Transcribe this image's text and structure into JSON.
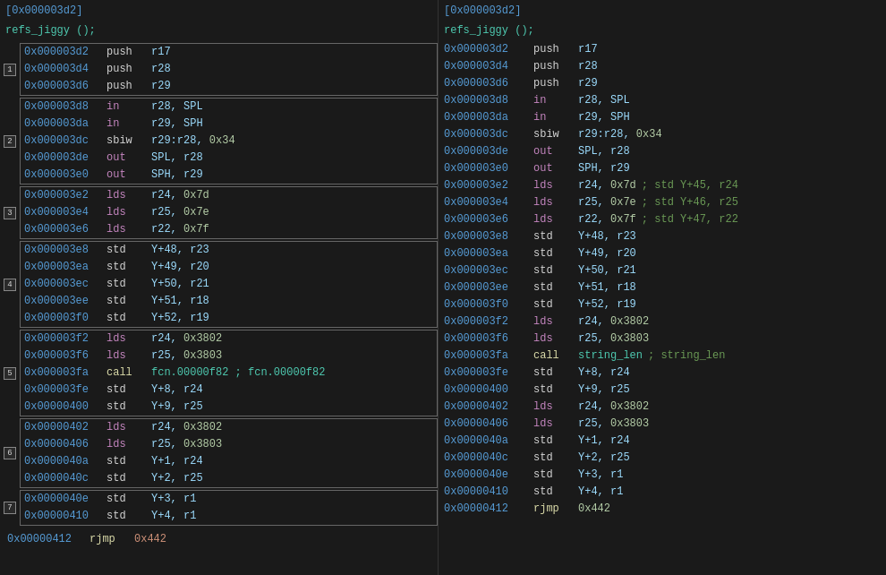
{
  "panels": [
    {
      "id": "left",
      "header_addr": "[0x000003d2]",
      "func_header": "refs_jiggy ();",
      "groups": [
        {
          "num": "1",
          "rows": [
            {
              "addr": "0x000003d2",
              "mnem": "push",
              "mnem_class": "c-grey",
              "ops": "r17",
              "ops_class": "c-light"
            },
            {
              "addr": "0x000003d4",
              "mnem": "push",
              "mnem_class": "c-grey",
              "ops": "r28",
              "ops_class": "c-light"
            },
            {
              "addr": "0x000003d6",
              "mnem": "push",
              "mnem_class": "c-grey",
              "ops": "r29",
              "ops_class": "c-light"
            }
          ]
        },
        {
          "num": "2",
          "rows": [
            {
              "addr": "0x000003d8",
              "mnem": "in",
              "mnem_class": "c-purple",
              "ops": "r28, SPL",
              "ops_class": "c-light"
            },
            {
              "addr": "0x000003da",
              "mnem": "in",
              "mnem_class": "c-purple",
              "ops": "r29, SPH",
              "ops_class": "c-light"
            },
            {
              "addr": "0x000003dc",
              "mnem": "sbiw",
              "mnem_class": "c-grey",
              "ops": "r29:r28, 0x34",
              "ops_class": "c-light",
              "ops_hex": "0x34"
            },
            {
              "addr": "0x000003de",
              "mnem": "out",
              "mnem_class": "c-purple",
              "ops": "SPL, r28",
              "ops_class": "c-light"
            },
            {
              "addr": "0x000003e0",
              "mnem": "out",
              "mnem_class": "c-purple",
              "ops": "SPH, r29",
              "ops_class": "c-light"
            }
          ]
        },
        {
          "num": "3",
          "rows": [
            {
              "addr": "0x000003e2",
              "mnem": "lds",
              "mnem_class": "c-purple",
              "ops": "r24, 0x7d",
              "ops_class": "c-light",
              "ops_hex": "0x7d"
            },
            {
              "addr": "0x000003e4",
              "mnem": "lds",
              "mnem_class": "c-purple",
              "ops": "r25, 0x7e",
              "ops_class": "c-light",
              "ops_hex": "0x7e"
            },
            {
              "addr": "0x000003e6",
              "mnem": "lds",
              "mnem_class": "c-purple",
              "ops": "r22, 0x7f",
              "ops_class": "c-light",
              "ops_hex": "0x7f"
            }
          ]
        },
        {
          "num": "4",
          "rows": [
            {
              "addr": "0x000003e8",
              "mnem": "std",
              "mnem_class": "c-grey",
              "ops": "Y+48, r23",
              "ops_class": "c-light"
            },
            {
              "addr": "0x000003ea",
              "mnem": "std",
              "mnem_class": "c-grey",
              "ops": "Y+49, r20",
              "ops_class": "c-light"
            },
            {
              "addr": "0x000003ec",
              "mnem": "std",
              "mnem_class": "c-grey",
              "ops": "Y+50, r21",
              "ops_class": "c-light"
            },
            {
              "addr": "0x000003ee",
              "mnem": "std",
              "mnem_class": "c-grey",
              "ops": "Y+51, r18",
              "ops_class": "c-light"
            },
            {
              "addr": "0x000003f0",
              "mnem": "std",
              "mnem_class": "c-grey",
              "ops": "Y+52, r19",
              "ops_class": "c-light"
            }
          ]
        },
        {
          "num": "5",
          "rows": [
            {
              "addr": "0x000003f2",
              "mnem": "lds",
              "mnem_class": "c-purple",
              "ops": "r24, 0x3802",
              "ops_class": "c-light",
              "ops_hex": "0x3802"
            },
            {
              "addr": "0x000003f6",
              "mnem": "lds",
              "mnem_class": "c-purple",
              "ops": "r25, 0x3803",
              "ops_class": "c-light",
              "ops_hex": "0x3803"
            },
            {
              "addr": "0x000003fa",
              "mnem": "call",
              "mnem_class": "c-yellow",
              "ops": "fcn.00000f82 ; fcn.00000f82",
              "ops_class": "c-teal"
            },
            {
              "addr": "0x000003fe",
              "mnem": "std",
              "mnem_class": "c-grey",
              "ops": "Y+8, r24",
              "ops_class": "c-light"
            },
            {
              "addr": "0x00000400",
              "mnem": "std",
              "mnem_class": "c-grey",
              "ops": "Y+9, r25",
              "ops_class": "c-light"
            }
          ]
        },
        {
          "num": "6",
          "rows": [
            {
              "addr": "0x00000402",
              "mnem": "lds",
              "mnem_class": "c-purple",
              "ops": "r24, 0x3802",
              "ops_class": "c-light",
              "ops_hex": "0x3802"
            },
            {
              "addr": "0x00000406",
              "mnem": "lds",
              "mnem_class": "c-purple",
              "ops": "r25, 0x3803",
              "ops_class": "c-light",
              "ops_hex": "0x3803"
            },
            {
              "addr": "0x0000040a",
              "mnem": "std",
              "mnem_class": "c-grey",
              "ops": "Y+1, r24",
              "ops_class": "c-light"
            },
            {
              "addr": "0x0000040c",
              "mnem": "std",
              "mnem_class": "c-grey",
              "ops": "Y+2, r25",
              "ops_class": "c-light"
            }
          ]
        },
        {
          "num": "7",
          "rows": [
            {
              "addr": "0x0000040e",
              "mnem": "std",
              "mnem_class": "c-grey",
              "ops": "Y+3, r1",
              "ops_class": "c-light"
            },
            {
              "addr": "0x00000410",
              "mnem": "std",
              "mnem_class": "c-grey",
              "ops": "Y+4, r1",
              "ops_class": "c-light"
            }
          ]
        }
      ],
      "footer_rows": [
        {
          "addr": "0x00000412",
          "mnem": "rjmp",
          "mnem_class": "c-yellow",
          "ops": "0x442",
          "ops_class": "c-orange"
        }
      ]
    },
    {
      "id": "right",
      "header_addr": "[0x000003d2]",
      "func_header": "refs_jiggy ();",
      "rows": [
        {
          "addr": "0x000003d2",
          "mnem": "push",
          "mnem_class": "c-grey",
          "ops": "r17",
          "comment": ""
        },
        {
          "addr": "0x000003d4",
          "mnem": "push",
          "mnem_class": "c-grey",
          "ops": "r28",
          "comment": ""
        },
        {
          "addr": "0x000003d6",
          "mnem": "push",
          "mnem_class": "c-grey",
          "ops": "r29",
          "comment": ""
        },
        {
          "addr": "0x000003d8",
          "mnem": "in",
          "mnem_class": "c-purple",
          "ops": "r28, SPL",
          "comment": ""
        },
        {
          "addr": "0x000003da",
          "mnem": "in",
          "mnem_class": "c-purple",
          "ops": "r29, SPH",
          "comment": ""
        },
        {
          "addr": "0x000003dc",
          "mnem": "sbiw",
          "mnem_class": "c-grey",
          "ops": "r29:r28, 0x34",
          "comment": ""
        },
        {
          "addr": "0x000003de",
          "mnem": "out",
          "mnem_class": "c-purple",
          "ops": "SPL, r28",
          "comment": ""
        },
        {
          "addr": "0x000003e0",
          "mnem": "out",
          "mnem_class": "c-purple",
          "ops": "SPH, r29",
          "comment": ""
        },
        {
          "addr": "0x000003e2",
          "mnem": "lds",
          "mnem_class": "c-purple",
          "ops": "r24, 0x7d",
          "comment": "; std Y+45, r24"
        },
        {
          "addr": "0x000003e4",
          "mnem": "lds",
          "mnem_class": "c-purple",
          "ops": "r25, 0x7e",
          "comment": "; std Y+46, r25"
        },
        {
          "addr": "0x000003e6",
          "mnem": "lds",
          "mnem_class": "c-purple",
          "ops": "r22, 0x7f",
          "comment": "; std Y+47, r22"
        },
        {
          "addr": "0x000003e8",
          "mnem": "std",
          "mnem_class": "c-grey",
          "ops": "Y+48, r23",
          "comment": ""
        },
        {
          "addr": "0x000003ea",
          "mnem": "std",
          "mnem_class": "c-grey",
          "ops": "Y+49, r20",
          "comment": ""
        },
        {
          "addr": "0x000003ec",
          "mnem": "std",
          "mnem_class": "c-grey",
          "ops": "Y+50, r21",
          "comment": ""
        },
        {
          "addr": "0x000003ee",
          "mnem": "std",
          "mnem_class": "c-grey",
          "ops": "Y+51, r18",
          "comment": ""
        },
        {
          "addr": "0x000003f0",
          "mnem": "std",
          "mnem_class": "c-grey",
          "ops": "Y+52, r19",
          "comment": ""
        },
        {
          "addr": "0x000003f2",
          "mnem": "lds",
          "mnem_class": "c-purple",
          "ops": "r24, 0x3802",
          "comment": ""
        },
        {
          "addr": "0x000003f6",
          "mnem": "lds",
          "mnem_class": "c-purple",
          "ops": "r25, 0x3803",
          "comment": ""
        },
        {
          "addr": "0x000003fa",
          "mnem": "call",
          "mnem_class": "c-yellow",
          "ops": "string_len",
          "comment": "; string_len",
          "ops_class": "c-teal"
        },
        {
          "addr": "0x000003fe",
          "mnem": "std",
          "mnem_class": "c-grey",
          "ops": "Y+8, r24",
          "comment": ""
        },
        {
          "addr": "0x00000400",
          "mnem": "std",
          "mnem_class": "c-grey",
          "ops": "Y+9, r25",
          "comment": ""
        },
        {
          "addr": "0x00000402",
          "mnem": "lds",
          "mnem_class": "c-purple",
          "ops": "r24, 0x3802",
          "comment": ""
        },
        {
          "addr": "0x00000406",
          "mnem": "lds",
          "mnem_class": "c-purple",
          "ops": "r25, 0x3803",
          "comment": ""
        },
        {
          "addr": "0x0000040a",
          "mnem": "std",
          "mnem_class": "c-grey",
          "ops": "Y+1, r24",
          "comment": ""
        },
        {
          "addr": "0x0000040c",
          "mnem": "std",
          "mnem_class": "c-grey",
          "ops": "Y+2, r25",
          "comment": ""
        },
        {
          "addr": "0x0000040e",
          "mnem": "std",
          "mnem_class": "c-grey",
          "ops": "Y+3, r1",
          "comment": ""
        },
        {
          "addr": "0x00000410",
          "mnem": "std",
          "mnem_class": "c-grey",
          "ops": "Y+4, r1",
          "comment": ""
        },
        {
          "addr": "0x00000412",
          "mnem": "rjmp",
          "mnem_class": "c-yellow",
          "ops": "0x442",
          "ops_class": "c-orange",
          "comment": ""
        }
      ]
    }
  ],
  "colors": {
    "bg": "#1a1a1a",
    "addr": "#569cd6",
    "purple": "#c586c0",
    "yellow": "#dcdcaa",
    "teal": "#4ec9b0",
    "orange": "#ce9178",
    "green": "#6a9955",
    "light": "#9cdcfe",
    "grey": "#d4d4d4"
  }
}
